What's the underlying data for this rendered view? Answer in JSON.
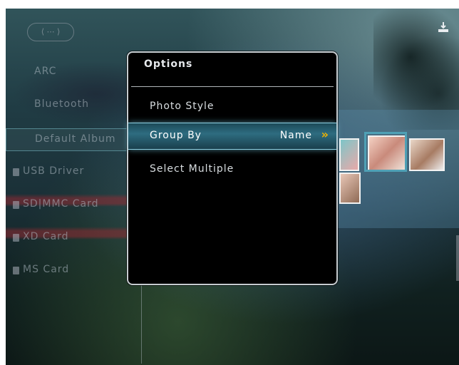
{
  "sidebar": {
    "items": [
      {
        "label": "ARC"
      },
      {
        "label": "Bluetooth"
      },
      {
        "label": "Default Album"
      },
      {
        "label": "USB Driver"
      },
      {
        "label": "SD|MMC Card"
      },
      {
        "label": "XD Card"
      },
      {
        "label": "MS Card"
      }
    ]
  },
  "dialog": {
    "title": "Options",
    "items": [
      {
        "label": "Photo Style",
        "value": ""
      },
      {
        "label": "Group By",
        "value": "Name"
      },
      {
        "label": "Select Multiple",
        "value": ""
      }
    ]
  },
  "icons": {
    "top_right": "import-icon",
    "chevron": "double-chevron-right-icon"
  },
  "colors": {
    "accent": "#2e6c80",
    "highlight_border": "#8fd3e6",
    "chevron": "#f0b400"
  }
}
